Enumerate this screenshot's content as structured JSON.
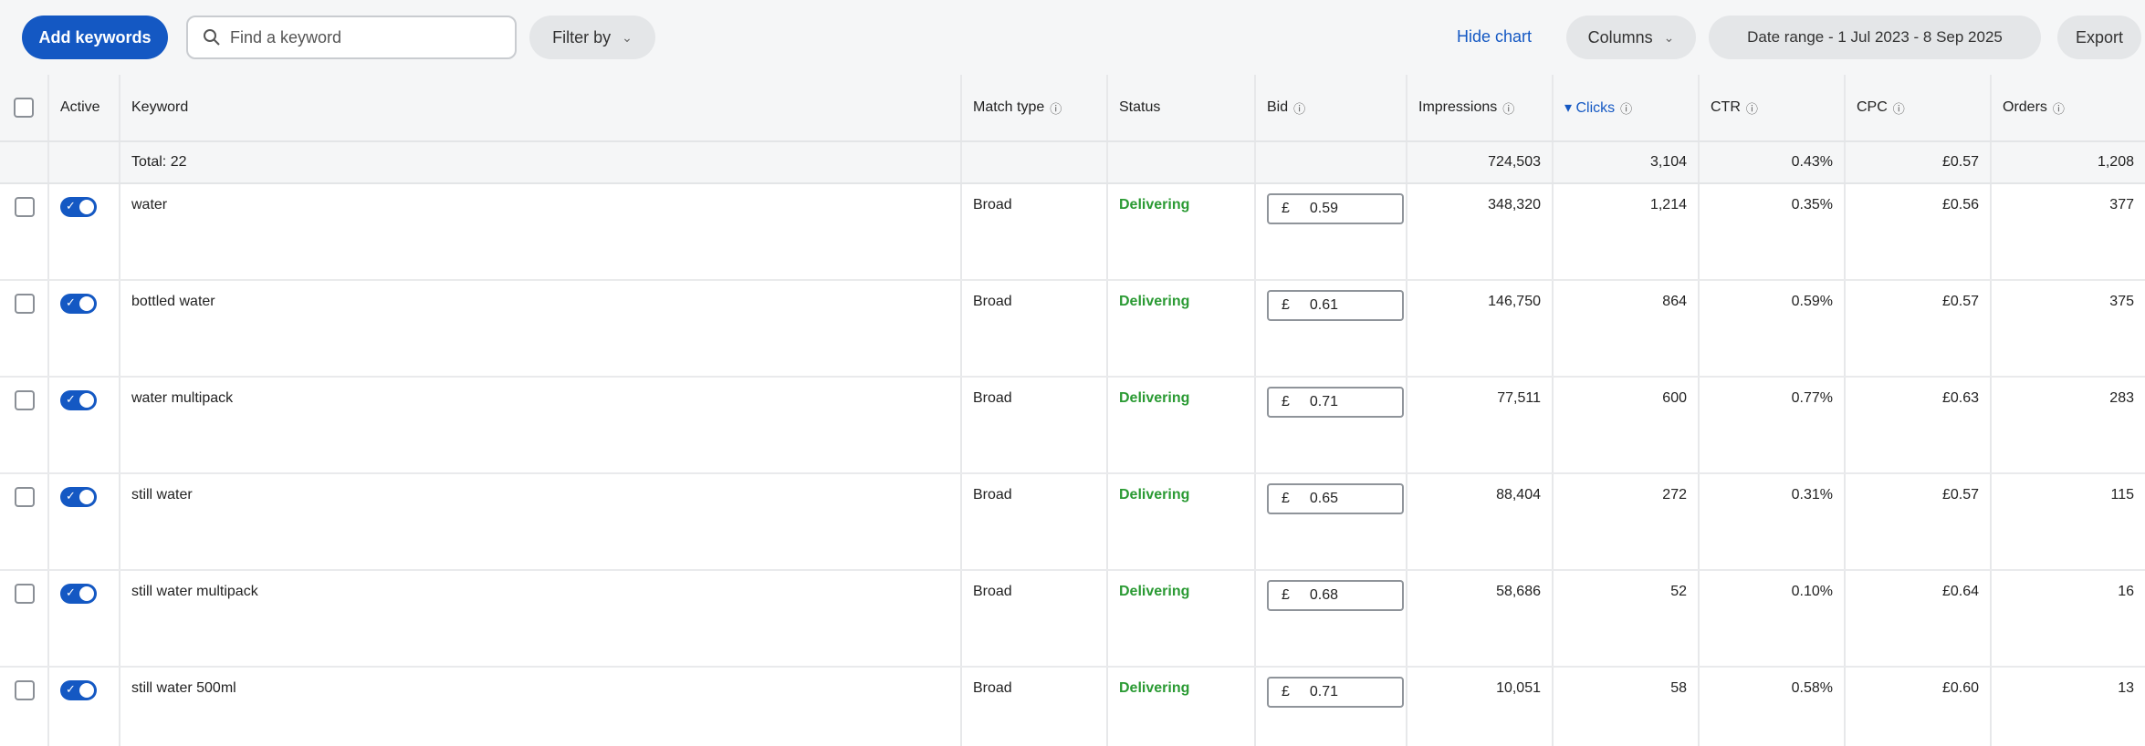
{
  "toolbar": {
    "add_keywords": "Add keywords",
    "search_placeholder": "Find a keyword",
    "filter_by": "Filter by",
    "hide_chart": "Hide chart",
    "columns": "Columns",
    "date_range": "Date range - 1 Jul 2023 - 8 Sep 2025",
    "export": "Export"
  },
  "table": {
    "headers": {
      "active": "Active",
      "keyword": "Keyword",
      "match_type": "Match type",
      "status": "Status",
      "bid": "Bid",
      "impressions": "Impressions",
      "clicks": "▾ Clicks",
      "ctr": "CTR",
      "cpc": "CPC",
      "orders": "Orders"
    },
    "total": {
      "label": "Total: 22",
      "impressions": "724,503",
      "clicks": "3,104",
      "ctr": "0.43%",
      "cpc": "£0.57",
      "orders": "1,208"
    },
    "currency": "£",
    "rows": [
      {
        "keyword": "water",
        "match_type": "Broad",
        "status": "Delivering",
        "bid": "0.59",
        "impressions": "348,320",
        "clicks": "1,214",
        "ctr": "0.35%",
        "cpc": "£0.56",
        "orders": "377"
      },
      {
        "keyword": "bottled water",
        "match_type": "Broad",
        "status": "Delivering",
        "bid": "0.61",
        "impressions": "146,750",
        "clicks": "864",
        "ctr": "0.59%",
        "cpc": "£0.57",
        "orders": "375"
      },
      {
        "keyword": "water multipack",
        "match_type": "Broad",
        "status": "Delivering",
        "bid": "0.71",
        "impressions": "77,511",
        "clicks": "600",
        "ctr": "0.77%",
        "cpc": "£0.63",
        "orders": "283"
      },
      {
        "keyword": "still water",
        "match_type": "Broad",
        "status": "Delivering",
        "bid": "0.65",
        "impressions": "88,404",
        "clicks": "272",
        "ctr": "0.31%",
        "cpc": "£0.57",
        "orders": "115"
      },
      {
        "keyword": "still water multipack",
        "match_type": "Broad",
        "status": "Delivering",
        "bid": "0.68",
        "impressions": "58,686",
        "clicks": "52",
        "ctr": "0.10%",
        "cpc": "£0.64",
        "orders": "16"
      },
      {
        "keyword": "still water 500ml",
        "match_type": "Broad",
        "status": "Delivering",
        "bid": "0.71",
        "impressions": "10,051",
        "clicks": "58",
        "ctr": "0.58%",
        "cpc": "£0.60",
        "orders": "13"
      }
    ]
  }
}
